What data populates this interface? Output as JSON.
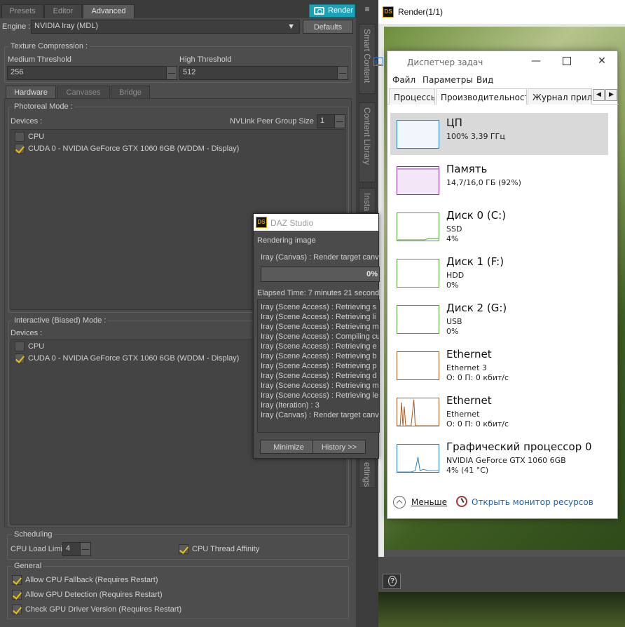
{
  "daz": {
    "tabs": [
      "Presets",
      "Editor",
      "Advanced"
    ],
    "render_label": "Render",
    "engine_label": "Engine :",
    "engine_value": "NVIDIA Iray (MDL)",
    "defaults_label": "Defaults",
    "texture": {
      "title": "Texture Compression :",
      "medium_label": "Medium Threshold",
      "medium_value": "256",
      "high_label": "High Threshold",
      "high_value": "512"
    },
    "subtabs": [
      "Hardware",
      "Canvases",
      "Bridge"
    ],
    "photoreal": {
      "title": "Photoreal Mode :",
      "devices_label": "Devices :",
      "nvlink_label": "NVLink Peer Group Size :",
      "nvlink_value": "1",
      "cpu": "CPU",
      "gpu": "CUDA 0 - NVIDIA GeForce GTX 1060 6GB (WDDM - Display)"
    },
    "interactive": {
      "title": "Interactive (Biased) Mode :",
      "devices_label": "Devices :",
      "cpu": "CPU",
      "gpu": "CUDA 0 - NVIDIA GeForce GTX 1060 6GB (WDDM - Display)"
    },
    "scheduling": {
      "title": "Scheduling",
      "cpu_load_label": "CPU Load Limit",
      "cpu_load_value": "4",
      "affinity_label": "CPU Thread Affinity"
    },
    "general": {
      "title": "General",
      "fallback": "Allow CPU Fallback (Requires Restart)",
      "detection": "Allow GPU Detection (Requires Restart)",
      "driver": "Check GPU Driver Version (Requires Restart)"
    },
    "side_tabs": [
      "Smart Content",
      "Content Library",
      "Insta",
      "ettings"
    ]
  },
  "dialog": {
    "title": "DAZ Studio",
    "icon_text": "DS",
    "status": "Rendering image",
    "target": "Iray (Canvas) : Render target canv",
    "progress": "0%",
    "elapsed": "Elapsed Time:  7 minutes 21 second",
    "log": [
      "Iray (Scene Access) : Retrieving s",
      "Iray (Scene Access) : Retrieving li",
      "Iray (Scene Access) : Retrieving m",
      "Iray (Scene Access) : Compiling cu",
      "Iray (Scene Access) : Retrieving e",
      "Iray (Scene Access) : Retrieving b",
      "Iray (Scene Access) : Retrieving p",
      "Iray (Scene Access) : Retrieving d",
      "Iray (Scene Access) : Retrieving m",
      "Iray (Scene Access) : Retrieving le",
      "Iray (Iteration) : 3",
      "Iray (Canvas) : Render target canv"
    ],
    "minimize": "Minimize",
    "history": "History >>"
  },
  "render_window": {
    "title": "Render(1/1)",
    "icon_text": "DS",
    "help": "?"
  },
  "taskmgr": {
    "title": "Диспетчер задач",
    "menu": [
      "Файл",
      "Параметры",
      "Вид"
    ],
    "tabs": [
      "Процессы",
      "Производительность",
      "Журнал прилож"
    ],
    "items": [
      {
        "title": "ЦП",
        "l1": "100% 3,39 ГГц",
        "l2": "",
        "color": "#1f7fc4"
      },
      {
        "title": "Память",
        "l1": "14,7/16,0 ГБ (92%)",
        "l2": "",
        "color": "#8b2fa0"
      },
      {
        "title": "Диск 0 (C:)",
        "l1": "SSD",
        "l2": "4%",
        "color": "#4da32b"
      },
      {
        "title": "Диск 1 (F:)",
        "l1": "HDD",
        "l2": "0%",
        "color": "#4da32b"
      },
      {
        "title": "Диск 2 (G:)",
        "l1": "USB",
        "l2": "0%",
        "color": "#4da32b"
      },
      {
        "title": "Ethernet",
        "l1": "Ethernet 3",
        "l2": "О: 0 П: 0 кбит/с",
        "color": "#a8581c"
      },
      {
        "title": "Ethernet",
        "l1": "Ethernet",
        "l2": "О: 0 П: 0 кбит/с",
        "color": "#a8581c"
      },
      {
        "title": "Графический процессор 0",
        "l1": "NVIDIA GeForce GTX 1060 6GB",
        "l2": "4% (41 °C)",
        "color": "#1f7fc4"
      }
    ],
    "less_label": "Меньше",
    "monitor_label": "Открыть монитор ресурсов"
  }
}
